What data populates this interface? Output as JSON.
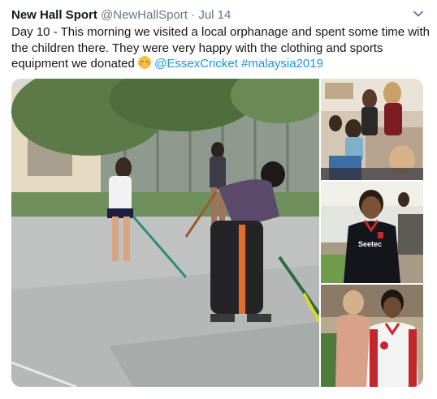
{
  "tweet": {
    "author_name": "New Hall Sport",
    "author_handle": "@NewHallSport",
    "separator": "·",
    "date": "Jul 14",
    "text_main": "Day 10 - This morning we visited a local orphanage and spent some time with the children there. They were very happy with the clothing and sports equipment we donated",
    "mention": "@EssexCricket",
    "hashtag": "#malaysia2019",
    "emoji": "smiling-face-with-blush-emoji",
    "menu_icon": "chevron-down-icon"
  },
  "media": {
    "photos": [
      {
        "name": "hockey-court-photo"
      },
      {
        "name": "classroom-group-photo"
      },
      {
        "name": "boy-seetec-shirt-photo"
      },
      {
        "name": "boy-red-shirt-photo"
      }
    ],
    "shirt_text": "Seetec"
  },
  "colors": {
    "text": "#14171a",
    "secondary": "#657786",
    "link": "#1b95e0"
  }
}
